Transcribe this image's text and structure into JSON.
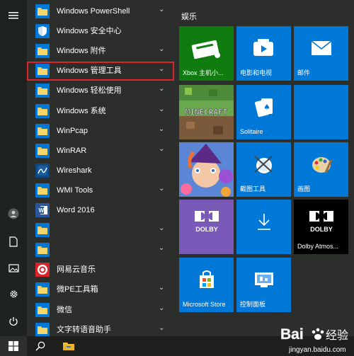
{
  "start_menu": {
    "apps": [
      {
        "name": "Windows PowerShell",
        "icon": "folder-icon",
        "has_chevron": true
      },
      {
        "name": "Windows 安全中心",
        "icon": "shield-icon",
        "has_chevron": false
      },
      {
        "name": "Windows 附件",
        "icon": "folder-icon",
        "has_chevron": true
      },
      {
        "name": "Windows 管理工具",
        "icon": "folder-icon",
        "has_chevron": true
      },
      {
        "name": "Windows 轻松使用",
        "icon": "folder-icon",
        "has_chevron": true
      },
      {
        "name": "Windows 系统",
        "icon": "folder-icon",
        "has_chevron": true
      },
      {
        "name": "WinPcap",
        "icon": "folder-icon",
        "has_chevron": true
      },
      {
        "name": "WinRAR",
        "icon": "folder-icon",
        "has_chevron": true
      },
      {
        "name": "Wireshark",
        "icon": "wireshark-icon",
        "has_chevron": false
      },
      {
        "name": "WMI Tools",
        "icon": "folder-icon",
        "has_chevron": true
      },
      {
        "name": "Word 2016",
        "icon": "word-icon",
        "has_chevron": false
      },
      {
        "name": "",
        "icon": "folder-icon",
        "has_chevron": true
      },
      {
        "name": "",
        "icon": "folder-icon",
        "has_chevron": true
      },
      {
        "name": "网易云音乐",
        "icon": "netease-music-icon",
        "has_chevron": false
      },
      {
        "name": "微PE工具箱",
        "icon": "folder-icon",
        "has_chevron": true
      },
      {
        "name": "微信",
        "icon": "folder-icon",
        "has_chevron": true
      },
      {
        "name": "文字转语音助手",
        "icon": "folder-icon",
        "has_chevron": true
      }
    ],
    "chevron_glyph": "⌄",
    "highlighted_app": "Windows 管理工具",
    "tile_group_title": "娱乐",
    "tiles": [
      {
        "label": "Xbox 主机小...",
        "icon": "xbox-console-icon",
        "color": "#107c10"
      },
      {
        "label": "电影和电视",
        "icon": "film-tv-icon",
        "color": "#0078d7"
      },
      {
        "label": "邮件",
        "icon": "mail-icon",
        "color": "#0078d7"
      },
      {
        "label": "",
        "icon": "minecraft-icon",
        "color": "#3c6e2c"
      },
      {
        "label": "Solitaire",
        "icon": "solitaire-icon",
        "color": "#0078d7"
      },
      {
        "label": "",
        "icon": "empty-tile",
        "color": "#0078d7"
      },
      {
        "label": "",
        "icon": "bubble-witch-icon",
        "color": "#4b7ac8"
      },
      {
        "label": "截图工具",
        "icon": "snipping-tool-icon",
        "color": "#0078d7"
      },
      {
        "label": "画图",
        "icon": "paint-icon",
        "color": "#0078d7"
      },
      {
        "label": "",
        "icon": "dolby-icon",
        "color": "#7a5ab8"
      },
      {
        "label": "",
        "icon": "download-icon",
        "color": "#0078d7"
      },
      {
        "label": "Dolby Atmos...",
        "icon": "dolby-icon",
        "color": "#000000"
      },
      {
        "label": "Microsoft Store",
        "icon": "store-icon",
        "color": "#0078d7"
      },
      {
        "label": "控制面板",
        "icon": "control-panel-icon",
        "color": "#0078d7"
      }
    ],
    "dolby_text": "DOLBY",
    "minecraft_text": "MINECRAFT",
    "rail_icons": [
      "hamburger-menu-icon",
      "user-icon",
      "document-icon",
      "pictures-icon",
      "settings-icon",
      "power-icon"
    ]
  },
  "taskbar": {
    "icons": [
      "windows-start-icon",
      "search-icon",
      "file-explorer-icon"
    ]
  },
  "watermark": {
    "brand": "Bai",
    "brand_suffix": "经验",
    "site": "jingyan.baidu.com"
  }
}
